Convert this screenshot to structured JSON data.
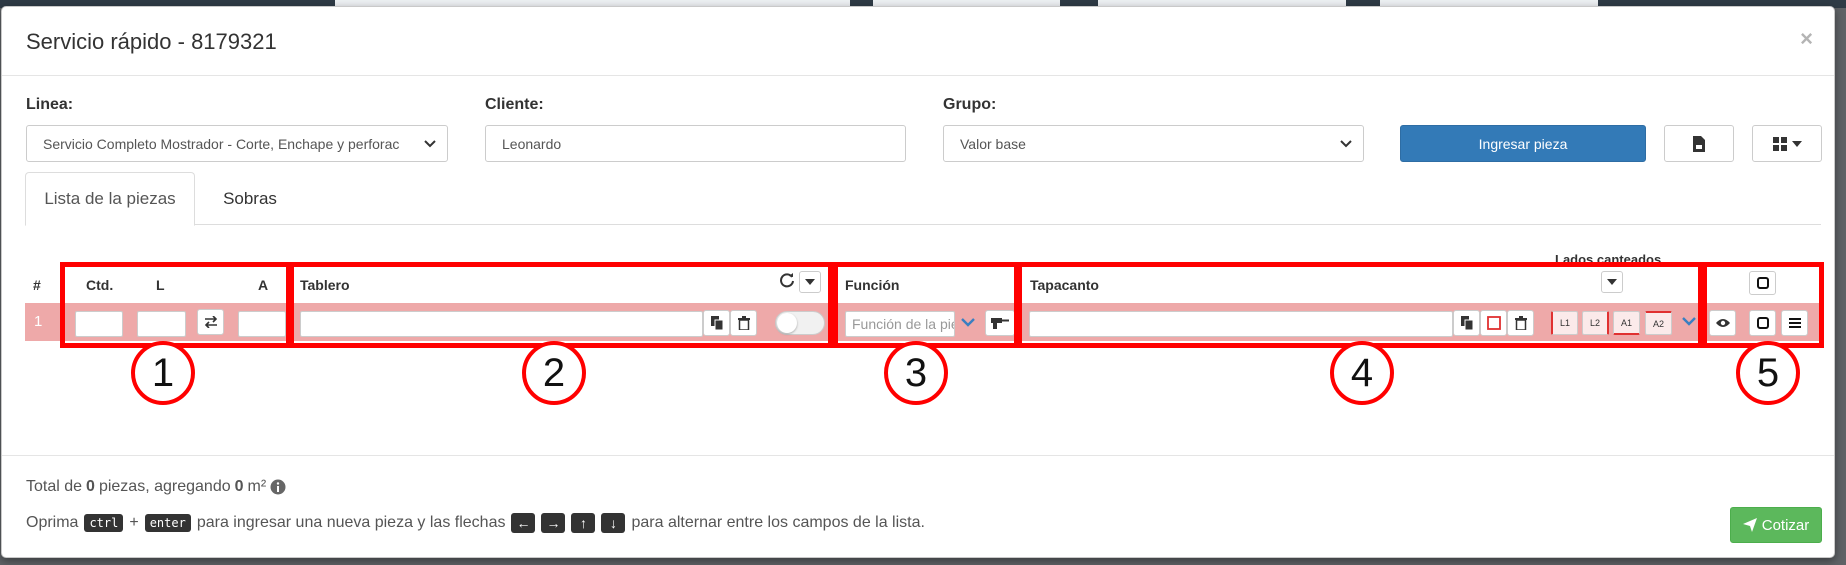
{
  "modal": {
    "title": "Servicio rápido - 8179321",
    "close": "×"
  },
  "form": {
    "linea_label": "Linea:",
    "linea_value": "Servicio Completo Mostrador - Corte, Enchape y perforac",
    "cliente_label": "Cliente:",
    "cliente_value": "Leonardo",
    "grupo_label": "Grupo:",
    "grupo_value": "Valor base",
    "ingresar_button": "Ingresar pieza"
  },
  "tabs": [
    {
      "label": "Lista de la piezas",
      "active": true
    },
    {
      "label": "Sobras",
      "active": false
    }
  ],
  "table": {
    "headers": {
      "num": "#",
      "ctd": "Ctd.",
      "l": "L",
      "a": "A",
      "tablero": "Tablero",
      "funcion": "Función",
      "tapacanto": "Tapacanto",
      "lados": "Lados canteados"
    },
    "row": {
      "number": "1",
      "funcion_placeholder": "Función de la pieza",
      "edge_buttons": [
        "L1",
        "L2",
        "A1",
        "A2"
      ]
    }
  },
  "annotations": [
    "1",
    "2",
    "3",
    "4",
    "5"
  ],
  "footer": {
    "total_prefix": "Total de",
    "pieces_count": "0",
    "pieces_suffix": "piezas, agregando",
    "area_value": "0",
    "area_unit": "m²",
    "hint_prefix": "Oprima",
    "key_ctrl": "ctrl",
    "plus": "+",
    "key_enter": "enter",
    "hint_middle": "para ingresar una nueva pieza y las flechas",
    "hint_suffix": "para alternar entre los campos de la lista.",
    "cotizar_button": "Cotizar"
  },
  "colors": {
    "primary": "#337ab7",
    "success": "#5cb85c",
    "row_highlight": "#eea9a9",
    "annotation": "#ff0000"
  },
  "icons": [
    "chevron-down-icon",
    "swap-icon",
    "copy-icon",
    "trash-icon",
    "refresh-icon",
    "caret-down-icon",
    "drill-icon",
    "square-outline-icon",
    "eye-icon",
    "menu-icon",
    "file-icon",
    "grid-icon",
    "info-icon",
    "send-icon",
    "arrow-left-icon",
    "arrow-right-icon",
    "arrow-up-icon",
    "arrow-down-icon"
  ]
}
